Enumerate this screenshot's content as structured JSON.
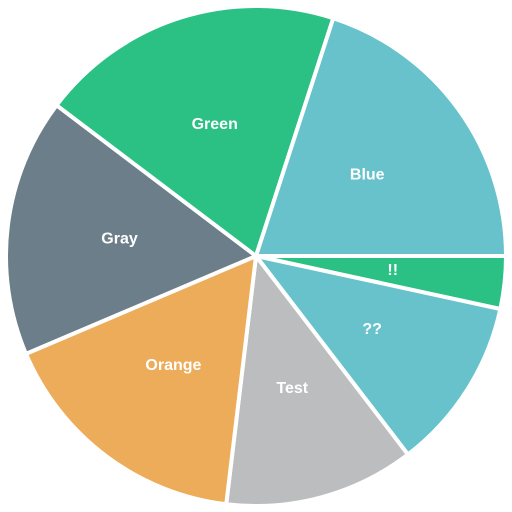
{
  "chart_data": {
    "type": "pie",
    "start_direction": "east",
    "direction": "clockwise",
    "slices": [
      {
        "label": "!!",
        "value": 3.4,
        "color": "#2bc084"
      },
      {
        "label": "??",
        "value": 11.2,
        "color": "#67c2cc"
      },
      {
        "label": "Test",
        "value": 12.3,
        "color": "#bbbdbe"
      },
      {
        "label": "Orange",
        "value": 16.7,
        "color": "#edac5a"
      },
      {
        "label": "Gray",
        "value": 16.7,
        "color": "#6c7e8a"
      },
      {
        "label": "Green",
        "value": 19.7,
        "color": "#2bc084"
      },
      {
        "label": "Blue",
        "value": 20.0,
        "color": "#67c2cc"
      }
    ]
  }
}
